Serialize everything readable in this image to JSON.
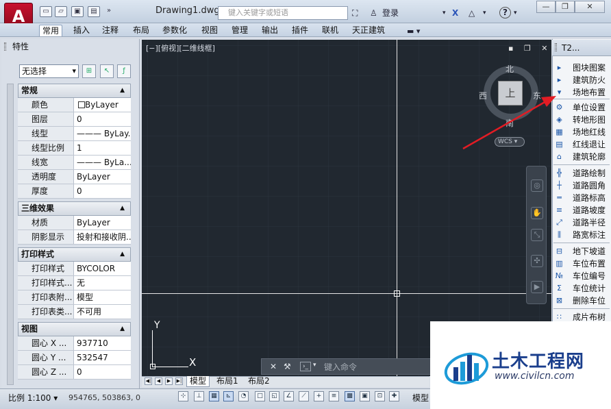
{
  "titlebar": {
    "app_letter": "A",
    "doc_title": "Drawing1.dwg",
    "search_placeholder": "键入关键字或短语",
    "login": "登录",
    "help": "?",
    "win_min": "—",
    "win_restore": "❐",
    "win_close": "✕"
  },
  "ribbon": {
    "tabs": [
      "常用",
      "插入",
      "注释",
      "布局",
      "参数化",
      "视图",
      "管理",
      "输出",
      "插件",
      "联机",
      "天正建筑"
    ],
    "active": "常用"
  },
  "props": {
    "title": "特性",
    "selection": "无选择",
    "sections": {
      "general": "常规",
      "three_d": "三维效果",
      "print": "打印样式",
      "view": "视图"
    },
    "general": [
      {
        "k": "颜色",
        "v": "ByLayer"
      },
      {
        "k": "图层",
        "v": "0"
      },
      {
        "k": "线型",
        "v": "——— ByLay..."
      },
      {
        "k": "线型比例",
        "v": "1"
      },
      {
        "k": "线宽",
        "v": "——— ByLa..."
      },
      {
        "k": "透明度",
        "v": "ByLayer"
      },
      {
        "k": "厚度",
        "v": "0"
      }
    ],
    "three_d": [
      {
        "k": "材质",
        "v": "ByLayer"
      },
      {
        "k": "阴影显示",
        "v": "投射和接收阴..."
      }
    ],
    "print": [
      {
        "k": "打印样式",
        "v": "BYCOLOR"
      },
      {
        "k": "打印样式...",
        "v": "无"
      },
      {
        "k": "打印表附...",
        "v": "模型"
      },
      {
        "k": "打印表类...",
        "v": "不可用"
      }
    ],
    "view": [
      {
        "k": "圆心 X ...",
        "v": "937710"
      },
      {
        "k": "圆心 Y ...",
        "v": "532547"
      },
      {
        "k": "圆心 Z ...",
        "v": "0"
      }
    ]
  },
  "viewport": {
    "label": "[−][俯视][二维线框]",
    "ctl": "▪ ❐ ✕",
    "compass": {
      "n": "北",
      "s": "南",
      "e": "东",
      "w": "西",
      "face": "上"
    },
    "wcs": "WCS",
    "ucs_x": "X",
    "ucs_y": "Y"
  },
  "command": {
    "placeholder": "键入命令"
  },
  "layouts": {
    "tabs": [
      "模型",
      "布局1",
      "布局2"
    ],
    "active": "模型"
  },
  "status": {
    "scale": "比例 1:100",
    "coords": "954765,   503863, 0",
    "model": "模型"
  },
  "t2": {
    "title": "T2...",
    "items": [
      {
        "icon": "▸",
        "label": "图块图案"
      },
      {
        "icon": "▸",
        "label": "建筑防火"
      },
      {
        "icon": "▾",
        "label": "场地布置"
      },
      {
        "icon": "⚙",
        "label": "单位设置"
      },
      {
        "icon": "◈",
        "label": "转地形图"
      },
      {
        "icon": "▦",
        "label": "场地红线"
      },
      {
        "icon": "▤",
        "label": "红线退让"
      },
      {
        "icon": "⌂",
        "label": "建筑轮廓"
      },
      {
        "icon": "╬",
        "label": "道路绘制"
      },
      {
        "icon": "┼",
        "label": "道路圆角"
      },
      {
        "icon": "═",
        "label": "道路标高"
      },
      {
        "icon": "≡",
        "label": "道路坡度"
      },
      {
        "icon": "⤢",
        "label": "道路半径"
      },
      {
        "icon": "⫼",
        "label": "路宽标注"
      },
      {
        "icon": "⊟",
        "label": "地下坡道"
      },
      {
        "icon": "▥",
        "label": "车位布置"
      },
      {
        "icon": "№",
        "label": "车位编号"
      },
      {
        "icon": "Σ",
        "label": "车位统计"
      },
      {
        "icon": "⊠",
        "label": "删除车位"
      },
      {
        "icon": "∷",
        "label": "成片布树"
      }
    ]
  },
  "watermark": {
    "title": "土木工程网",
    "url": "www.civilcn.com"
  }
}
